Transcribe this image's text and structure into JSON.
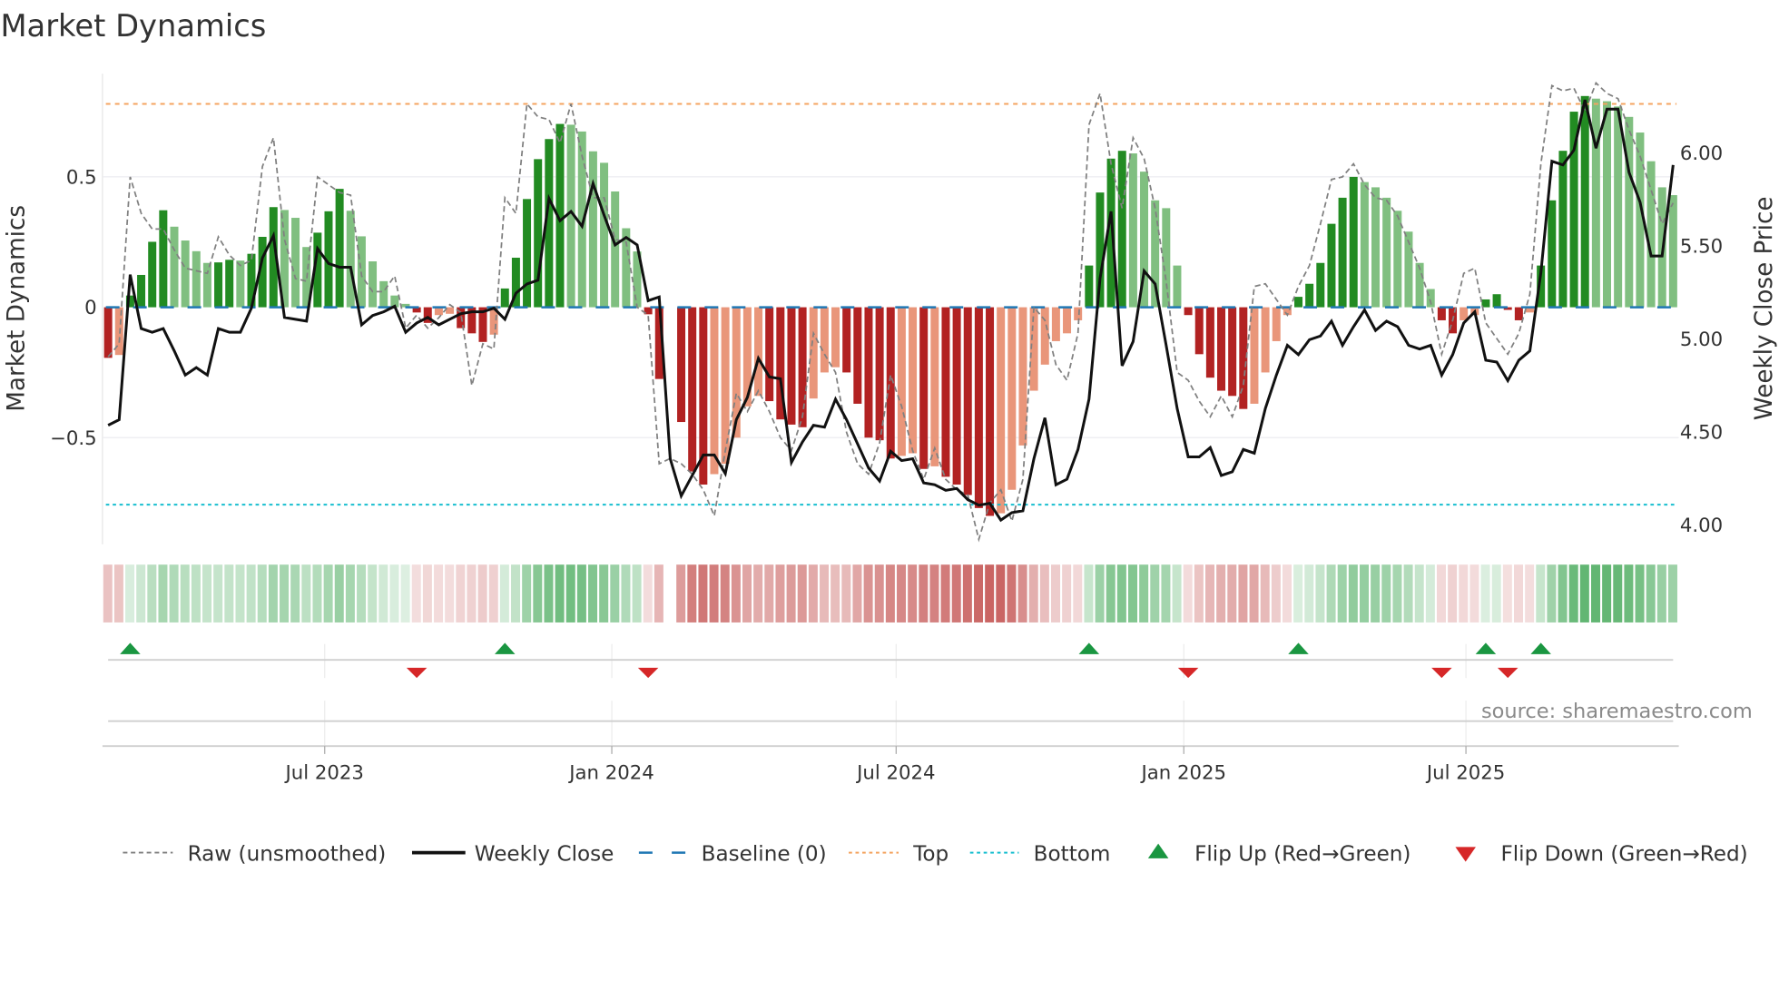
{
  "chart_data": {
    "type": "bar",
    "title": "Market Dynamics",
    "ylabel_left": "Market Dynamics",
    "ylabel_right": "Weekly Close Price",
    "ylim_left": [
      -0.91,
      0.9
    ],
    "ylim_right": [
      3.9,
      6.4
    ],
    "left_ticks": [
      {
        "v": 0.5,
        "label": "0.5"
      },
      {
        "v": 0,
        "label": "0"
      },
      {
        "v": -0.5,
        "label": "−0.5"
      }
    ],
    "right_ticks": [
      {
        "v": 6.0,
        "label": "6.00"
      },
      {
        "v": 5.5,
        "label": "5.50"
      },
      {
        "v": 5.0,
        "label": "5.00"
      },
      {
        "v": 4.5,
        "label": "4.50"
      },
      {
        "v": 4.0,
        "label": "4.00"
      }
    ],
    "x_unit": "week index",
    "x_ticks": [
      {
        "week": 19.65,
        "label": "Jul 2023"
      },
      {
        "week": 45.7,
        "label": "Jan 2024"
      },
      {
        "week": 71.5,
        "label": "Jul 2024"
      },
      {
        "week": 97.6,
        "label": "Jan 2025"
      },
      {
        "week": 123.2,
        "label": "Jul 2025"
      }
    ],
    "top_level": 0.78,
    "bottom_level": -0.757,
    "baseline": 0,
    "values": [
      -0.194,
      -0.183,
      0.045,
      0.124,
      0.251,
      0.372,
      0.309,
      0.256,
      0.215,
      0.17,
      0.172,
      0.182,
      0.179,
      0.205,
      0.27,
      0.384,
      0.373,
      0.343,
      0.231,
      0.286,
      0.368,
      0.454,
      0.37,
      0.272,
      0.176,
      0.1,
      0.045,
      0.013,
      -0.02,
      -0.06,
      -0.03,
      -0.025,
      -0.08,
      -0.1,
      -0.133,
      -0.105,
      0.072,
      0.19,
      0.415,
      0.568,
      0.645,
      0.703,
      0.7,
      0.674,
      0.598,
      0.554,
      0.444,
      0.303,
      0.214,
      -0.027,
      -0.275,
      null,
      -0.44,
      -0.63,
      -0.68,
      -0.64,
      -0.6,
      -0.5,
      -0.38,
      -0.34,
      -0.36,
      -0.43,
      -0.45,
      -0.46,
      -0.35,
      -0.25,
      -0.23,
      -0.25,
      -0.37,
      -0.5,
      -0.51,
      -0.58,
      -0.57,
      -0.56,
      -0.62,
      -0.61,
      -0.65,
      -0.68,
      -0.72,
      -0.77,
      -0.8,
      -0.79,
      -0.7,
      -0.53,
      -0.32,
      -0.22,
      -0.13,
      -0.1,
      -0.05,
      0.16,
      0.44,
      0.57,
      0.6,
      0.59,
      0.52,
      0.41,
      0.38,
      0.16,
      -0.03,
      -0.18,
      -0.27,
      -0.32,
      -0.34,
      -0.39,
      -0.37,
      -0.25,
      -0.13,
      -0.03,
      0.04,
      0.09,
      0.17,
      0.32,
      0.42,
      0.5,
      0.48,
      0.46,
      0.42,
      0.37,
      0.29,
      0.17,
      0.07,
      -0.05,
      -0.1,
      -0.05,
      -0.03,
      0.03,
      0.05,
      -0.01,
      -0.05,
      -0.02,
      0.16,
      0.41,
      0.6,
      0.75,
      0.81,
      0.8,
      0.79,
      0.77,
      0.73,
      0.67,
      0.56,
      0.46,
      0.43
    ],
    "raw": [
      -0.19,
      -0.14,
      0.5,
      0.36,
      0.3,
      0.3,
      0.22,
      0.15,
      0.14,
      0.13,
      0.27,
      0.2,
      0.16,
      0.18,
      0.54,
      0.65,
      0.26,
      0.11,
      0.1,
      0.5,
      0.47,
      0.44,
      0.43,
      0.12,
      0.06,
      0.06,
      0.12,
      -0.08,
      -0.03,
      -0.08,
      -0.04,
      0.01,
      -0.02,
      -0.3,
      -0.14,
      -0.16,
      0.42,
      0.36,
      0.78,
      0.73,
      0.72,
      0.63,
      0.78,
      0.58,
      0.42,
      0.42,
      0.26,
      0.25,
      0.0,
      -0.03,
      -0.6,
      -0.58,
      -0.6,
      -0.64,
      -0.7,
      -0.8,
      -0.55,
      -0.33,
      -0.4,
      -0.32,
      -0.4,
      -0.5,
      -0.55,
      -0.42,
      -0.1,
      -0.18,
      -0.25,
      -0.48,
      -0.6,
      -0.64,
      -0.52,
      -0.26,
      -0.38,
      -0.55,
      -0.66,
      -0.54,
      -0.66,
      -0.7,
      -0.72,
      -0.89,
      -0.75,
      -0.7,
      -0.82,
      -0.66,
      0.0,
      -0.05,
      -0.22,
      -0.28,
      -0.1,
      0.7,
      0.82,
      0.55,
      0.38,
      0.65,
      0.57,
      0.38,
      0.1,
      -0.25,
      -0.28,
      -0.36,
      -0.42,
      -0.34,
      -0.42,
      -0.3,
      0.08,
      0.09,
      0.03,
      -0.03,
      0.08,
      0.16,
      0.32,
      0.49,
      0.5,
      0.55,
      0.47,
      0.42,
      0.41,
      0.35,
      0.25,
      0.15,
      0.02,
      -0.18,
      -0.05,
      0.13,
      0.15,
      -0.06,
      -0.12,
      -0.18,
      -0.1,
      0.05,
      0.55,
      0.85,
      0.83,
      0.84,
      0.75,
      0.86,
      0.82,
      0.8,
      0.68,
      0.58,
      0.45,
      0.32,
      0.4
    ],
    "close": [
      4.53,
      4.56,
      5.34,
      5.05,
      5.03,
      5.05,
      4.93,
      4.8,
      4.84,
      4.8,
      5.05,
      5.03,
      5.03,
      5.16,
      5.43,
      5.55,
      5.11,
      5.1,
      5.09,
      5.48,
      5.4,
      5.38,
      5.38,
      5.07,
      5.12,
      5.14,
      5.17,
      5.03,
      5.08,
      5.11,
      5.07,
      5.1,
      5.13,
      5.14,
      5.14,
      5.16,
      5.1,
      5.24,
      5.29,
      5.31,
      5.75,
      5.63,
      5.68,
      5.6,
      5.83,
      5.66,
      5.5,
      5.54,
      5.5,
      5.2,
      5.22,
      4.35,
      4.15,
      4.26,
      4.37,
      4.37,
      4.27,
      4.56,
      4.68,
      4.89,
      4.79,
      4.78,
      4.33,
      4.44,
      4.53,
      4.52,
      4.67,
      4.56,
      4.43,
      4.3,
      4.23,
      4.39,
      4.34,
      4.35,
      4.22,
      4.21,
      4.18,
      4.19,
      4.13,
      4.1,
      4.11,
      4.02,
      4.06,
      4.07,
      4.35,
      4.57,
      4.21,
      4.24,
      4.4,
      4.67,
      5.32,
      5.68,
      4.85,
      4.98,
      5.36,
      5.29,
      4.96,
      4.62,
      4.36,
      4.36,
      4.41,
      4.26,
      4.28,
      4.4,
      4.38,
      4.62,
      4.8,
      4.96,
      4.91,
      4.99,
      5.01,
      5.09,
      4.96,
      5.06,
      5.15,
      5.04,
      5.09,
      5.06,
      4.96,
      4.94,
      4.96,
      4.8,
      4.91,
      5.08,
      5.14,
      4.88,
      4.87,
      4.77,
      4.88,
      4.93,
      5.35,
      5.95,
      5.93,
      6.01,
      6.28,
      6.02,
      6.23,
      6.23,
      5.89,
      5.73,
      5.44,
      5.44,
      5.93
    ],
    "flip_up": [
      2,
      36,
      89,
      108,
      125,
      130
    ],
    "flip_down": [
      28,
      49,
      98,
      121,
      127
    ],
    "colors": {
      "green_strong": "#228b22",
      "green_weak": "#80bf80",
      "red_strong": "#b22222",
      "red_weak": "#e9967a",
      "strip_green": "#2e9e44",
      "strip_red": "#b8312f",
      "top": "#f4a460",
      "bottom": "#17becf",
      "baseline": "#1f77b4",
      "raw": "#808080",
      "close": "#111111",
      "flip_up": "#1a9641",
      "flip_down": "#d62728"
    },
    "legend": [
      {
        "key": "raw",
        "label": "Raw (unsmoothed)"
      },
      {
        "key": "close",
        "label": "Weekly Close"
      },
      {
        "key": "baseline",
        "label": "Baseline (0)"
      },
      {
        "key": "top",
        "label": "Top"
      },
      {
        "key": "bottom",
        "label": "Bottom"
      },
      {
        "key": "flip_up",
        "label": "Flip Up (Red→Green)"
      },
      {
        "key": "flip_down",
        "label": "Flip Down (Green→Red)"
      }
    ],
    "legend_position": "bottom",
    "source": "source: sharemaestro.com"
  }
}
